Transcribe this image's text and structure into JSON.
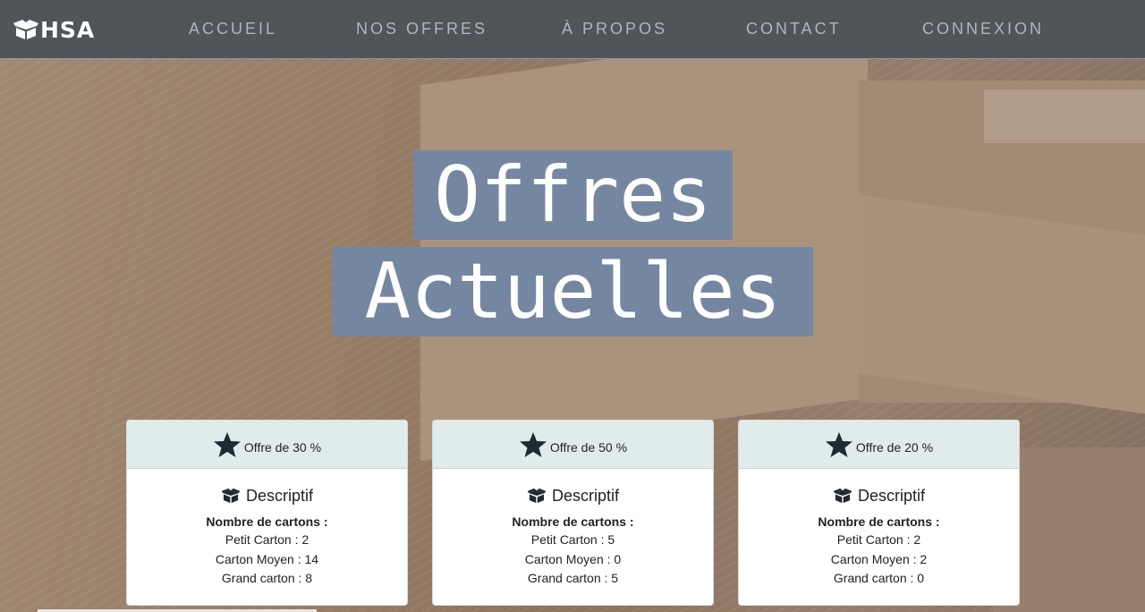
{
  "brand": {
    "name": "HSA",
    "icon": "box-open-icon"
  },
  "nav": {
    "items": [
      {
        "label": "ACCUEIL"
      },
      {
        "label": "NOS OFFRES"
      },
      {
        "label": "À PROPOS"
      },
      {
        "label": "CONTACT"
      },
      {
        "label": "CONNEXION"
      }
    ]
  },
  "hero": {
    "title_line1": "Offres",
    "title_line2": "Actuelles"
  },
  "cards": [
    {
      "icon": "star-icon",
      "offer": "Offre de 30 %",
      "desc_icon": "box-open-icon",
      "desc_title": "Descriptif",
      "count_label": "Nombre de cartons :",
      "lines": [
        "Petit Carton : 2",
        "Carton Moyen : 14",
        "Grand carton : 8"
      ]
    },
    {
      "icon": "star-icon",
      "offer": "Offre de 50 %",
      "desc_icon": "box-open-icon",
      "desc_title": "Descriptif",
      "count_label": "Nombre de cartons :",
      "lines": [
        "Petit Carton : 5",
        "Carton Moyen : 0",
        "Grand carton : 5"
      ]
    },
    {
      "icon": "star-icon",
      "offer": "Offre de 20 %",
      "desc_icon": "box-open-icon",
      "desc_title": "Descriptif",
      "count_label": "Nombre de cartons :",
      "lines": [
        "Petit Carton : 2",
        "Carton Moyen : 2",
        "Grand carton : 0"
      ]
    }
  ],
  "colors": {
    "navbar": "#505559",
    "nav_text": "#aeb6be",
    "title_highlight": "#7587a0",
    "card_header": "#e0eceb",
    "icon_dark": "#1f2a33"
  }
}
